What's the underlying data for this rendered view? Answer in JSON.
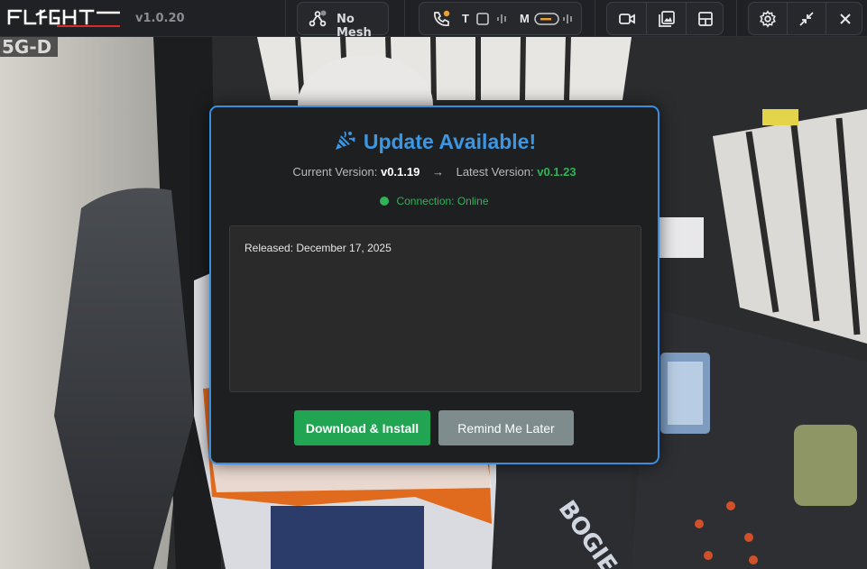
{
  "app": {
    "logo_text": "FLIGHT",
    "version": "v1.0.20"
  },
  "toolbar": {
    "mesh_status": "No Mesh",
    "radio_t_label": "T",
    "radio_m_label": "M",
    "icons": [
      "mesh-network-icon",
      "phone-icon",
      "video-camera-icon",
      "gallery-icon",
      "layout-icon",
      "settings-gear-icon",
      "minimize-arrows-icon",
      "close-icon"
    ]
  },
  "camera": {
    "label": "5G-D"
  },
  "dialog": {
    "title": "Update Available!",
    "current_version_label": "Current Version:",
    "current_version": "v0.1.19",
    "arrow": "→",
    "latest_version_label": "Latest Version:",
    "latest_version": "v0.1.23",
    "connection_status": "Connection: Online",
    "release_notes": "Released: December 17, 2025",
    "primary_button": "Download & Install",
    "secondary_button": "Remind Me Later"
  },
  "colors": {
    "accent": "#3b97e4",
    "success": "#2fb35a",
    "primary_button": "#22a553",
    "secondary_button": "#7f8c8d",
    "logo_red": "#d62b2b"
  }
}
